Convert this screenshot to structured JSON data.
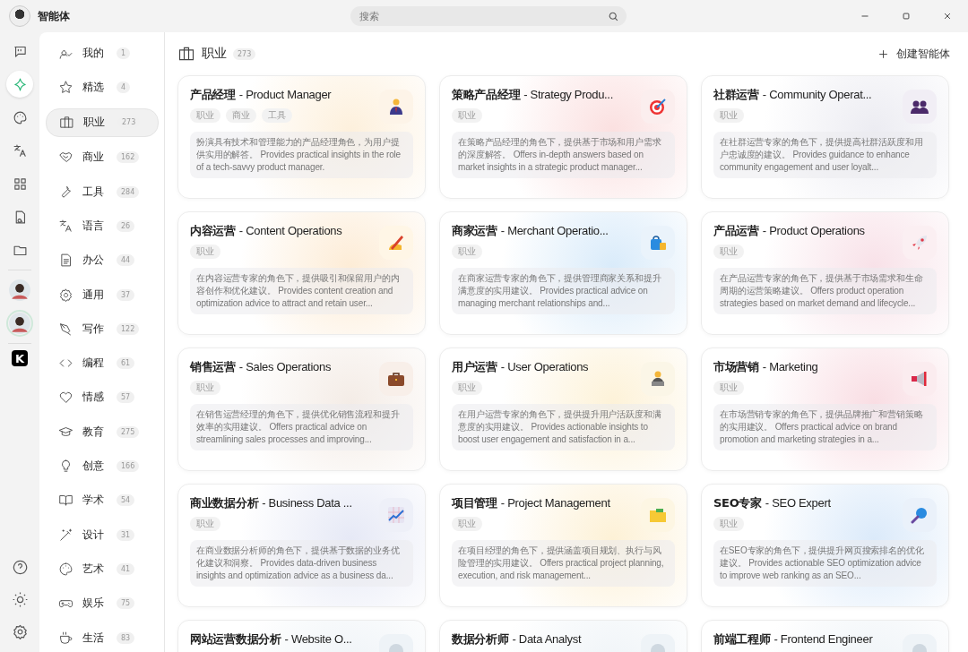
{
  "window": {
    "title": "智能体",
    "search": {
      "placeholder": "搜索"
    }
  },
  "rail": {
    "items": [
      {
        "kind": "chat",
        "selected": false
      },
      {
        "kind": "sparkle",
        "selected": true
      },
      {
        "kind": "palette",
        "selected": false
      },
      {
        "kind": "translate",
        "selected": false
      },
      {
        "kind": "grid",
        "selected": false
      },
      {
        "kind": "file-search",
        "selected": false
      },
      {
        "kind": "folder",
        "selected": false
      }
    ],
    "avatars": [
      {
        "selected": false
      },
      {
        "selected": true
      }
    ],
    "apps": [
      {
        "label": "K"
      }
    ],
    "bottom": [
      {
        "kind": "help"
      },
      {
        "kind": "brightness"
      },
      {
        "kind": "settings"
      }
    ]
  },
  "categories": [
    {
      "label": "我的",
      "count": "1",
      "selected": false
    },
    {
      "label": "精选",
      "count": "4",
      "selected": false
    },
    {
      "label": "职业",
      "count": "273",
      "selected": true
    },
    {
      "label": "商业",
      "count": "162",
      "selected": false
    },
    {
      "label": "工具",
      "count": "284",
      "selected": false
    },
    {
      "label": "语言",
      "count": "26",
      "selected": false
    },
    {
      "label": "办公",
      "count": "44",
      "selected": false
    },
    {
      "label": "通用",
      "count": "37",
      "selected": false
    },
    {
      "label": "写作",
      "count": "122",
      "selected": false
    },
    {
      "label": "编程",
      "count": "61",
      "selected": false
    },
    {
      "label": "情感",
      "count": "57",
      "selected": false
    },
    {
      "label": "教育",
      "count": "275",
      "selected": false
    },
    {
      "label": "创意",
      "count": "166",
      "selected": false
    },
    {
      "label": "学术",
      "count": "54",
      "selected": false
    },
    {
      "label": "设计",
      "count": "31",
      "selected": false
    },
    {
      "label": "艺术",
      "count": "41",
      "selected": false
    },
    {
      "label": "娱乐",
      "count": "75",
      "selected": false
    },
    {
      "label": "生活",
      "count": "83",
      "selected": false
    }
  ],
  "header": {
    "title": "职业",
    "count": "273",
    "create_button": "创建智能体"
  },
  "cards": [
    {
      "title_zh": "产品经理",
      "title_en": "- Product Manager",
      "tags": [
        "职业",
        "商业",
        "工具"
      ],
      "description": "扮演具有技术和管理能力的产品经理角色，为用户提供实用的解答。 Provides practical insights in the role of a tech-savvy product manager."
    },
    {
      "title_zh": "策略产品经理",
      "title_en": "- Strategy Produ...",
      "tags": [
        "职业"
      ],
      "description": "在策略产品经理的角色下，提供基于市场和用户需求的深度解答。 Offers in-depth answers based on market insights in a strategic product manager..."
    },
    {
      "title_zh": "社群运营",
      "title_en": "- Community Operat...",
      "tags": [
        "职业"
      ],
      "description": "在社群运营专家的角色下，提供提高社群活跃度和用户忠诚度的建议。 Provides guidance to enhance community engagement and user loyalt..."
    },
    {
      "title_zh": "内容运营",
      "title_en": "- Content Operations",
      "tags": [
        "职业"
      ],
      "description": "在内容运营专家的角色下，提供吸引和保留用户的内容创作和优化建议。 Provides content creation and optimization advice to attract and retain user..."
    },
    {
      "title_zh": "商家运营",
      "title_en": "- Merchant Operatio...",
      "tags": [
        "职业"
      ],
      "description": "在商家运营专家的角色下，提供管理商家关系和提升满意度的实用建议。 Provides practical advice on managing merchant relationships and..."
    },
    {
      "title_zh": "产品运营",
      "title_en": "- Product Operations",
      "tags": [
        "职业"
      ],
      "description": "在产品运营专家的角色下，提供基于市场需求和生命周期的运营策略建议。 Offers product operation strategies based on market demand and lifecycle..."
    },
    {
      "title_zh": "销售运营",
      "title_en": "- Sales Operations",
      "tags": [
        "职业"
      ],
      "description": "在销售运营经理的角色下，提供优化销售流程和提升效率的实用建议。 Offers practical advice on streamlining sales processes and improving..."
    },
    {
      "title_zh": "用户运营",
      "title_en": "- User Operations",
      "tags": [
        "职业"
      ],
      "description": "在用户运营专家的角色下，提供提升用户活跃度和满意度的实用建议。 Provides actionable insights to boost user engagement and satisfaction in a..."
    },
    {
      "title_zh": "市场营销",
      "title_en": "- Marketing",
      "tags": [
        "职业"
      ],
      "description": "在市场营销专家的角色下，提供品牌推广和营销策略的实用建议。 Offers practical advice on brand promotion and marketing strategies in a..."
    },
    {
      "title_zh": "商业数据分析",
      "title_en": "- Business Data ...",
      "tags": [
        "职业"
      ],
      "description": "在商业数据分析师的角色下，提供基于数据的业务优化建议和洞察。 Provides data-driven business insights and optimization advice as a business da..."
    },
    {
      "title_zh": "项目管理",
      "title_en": "- Project Management",
      "tags": [
        "职业"
      ],
      "description": "在项目经理的角色下，提供涵盖项目规划、执行与风险管理的实用建议。 Offers practical project planning, execution, and risk management..."
    },
    {
      "title_zh": "SEO专家",
      "title_en": "- SEO Expert",
      "tags": [
        "职业"
      ],
      "description": "在SEO专家的角色下，提供提升网页搜索排名的优化建议。 Provides actionable SEO optimization advice to improve web ranking as an SEO..."
    },
    {
      "title_zh": "网站运营数据分析",
      "title_en": "- Website O..."
    },
    {
      "title_zh": "数据分析师",
      "title_en": "- Data Analyst"
    },
    {
      "title_zh": "前端工程师",
      "title_en": "- Frontend Engineer"
    }
  ]
}
